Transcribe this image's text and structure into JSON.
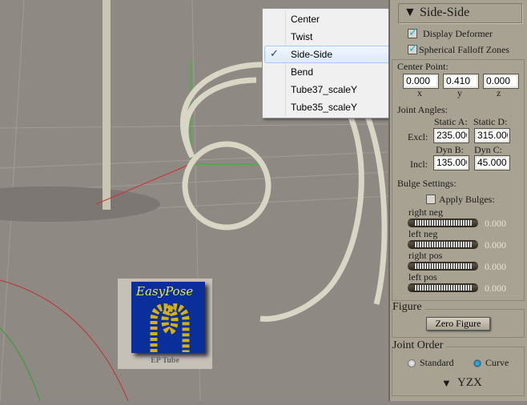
{
  "menu": {
    "items": [
      {
        "label": "Center"
      },
      {
        "label": "Twist"
      },
      {
        "label": "Side-Side",
        "checked": true
      },
      {
        "label": "Bend"
      },
      {
        "label": "Tube37_scaleY"
      },
      {
        "label": "Tube35_scaleY"
      }
    ]
  },
  "panel": {
    "header": "Side-Side",
    "display_deformer": {
      "label": "Display Deformer",
      "checked": true
    },
    "spherical_falloff": {
      "label": "Spherical Falloff Zones",
      "checked": true
    },
    "center_point": {
      "label": "Center Point:",
      "x": "0.000",
      "y": "0.410",
      "z": "0.000",
      "x_label": "x",
      "y_label": "y",
      "z_label": "z"
    },
    "joint_angles": {
      "label": "Joint Angles:",
      "static_a_label": "Static A:",
      "static_d_label": "Static D:",
      "excl_label": "Excl:",
      "static_a": "235.000",
      "static_d": "315.000",
      "dyn_b_label": "Dyn B:",
      "dyn_c_label": "Dyn C:",
      "incl_label": "Incl:",
      "dyn_b": "135.000",
      "dyn_c": "45.000"
    },
    "bulge": {
      "label": "Bulge Settings:",
      "apply_label": "Apply Bulges:",
      "apply_checked": false,
      "sliders": [
        {
          "label": "right neg",
          "value": "0.000"
        },
        {
          "label": "left neg",
          "value": "0.000"
        },
        {
          "label": "right pos",
          "value": "0.000"
        },
        {
          "label": "left pos",
          "value": "0.000"
        }
      ]
    },
    "figure": {
      "label": "Figure",
      "zero_button": "Zero Figure"
    },
    "joint_order": {
      "label": "Joint Order",
      "standard": "Standard",
      "curve": "Curve",
      "selected": "Curve",
      "order": "YZX"
    }
  },
  "logo": {
    "title": "EasyPose",
    "caption": "EP Tube"
  },
  "colors": {
    "viewport": "#8e8983",
    "panel": "#a7a292",
    "logo_blue": "#0a2e9a",
    "logo_text": "#e8e840"
  }
}
